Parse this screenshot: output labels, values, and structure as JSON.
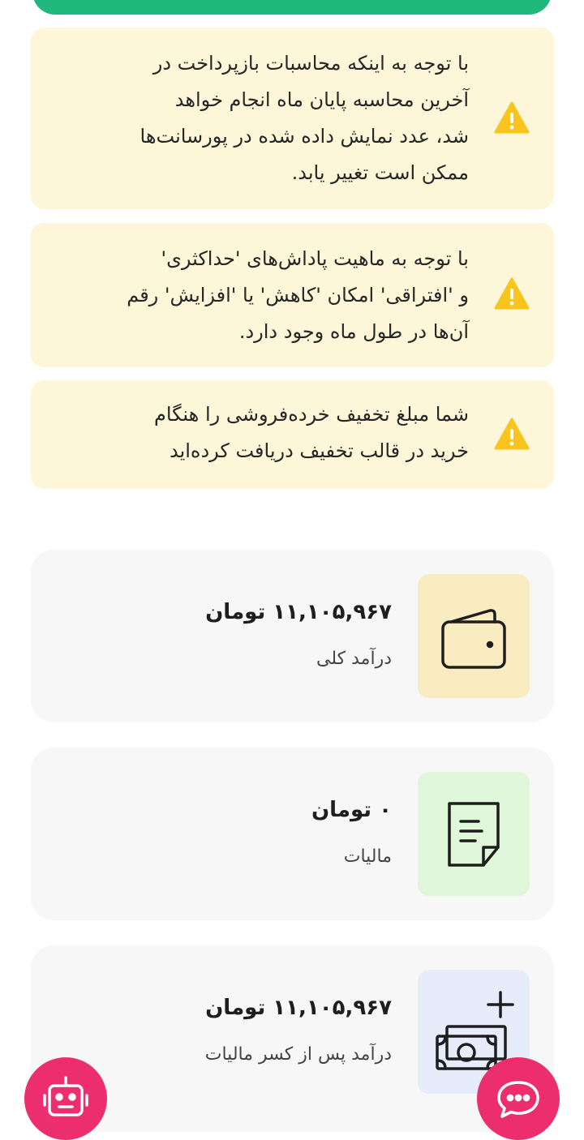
{
  "colors": {
    "accent_green": "#1fb77a",
    "notice_bg": "#fdf6d8",
    "warning_yellow": "#f7c51e",
    "card_bg": "#f7f7f7",
    "wallet_tile": "#f8ecc0",
    "tax_tile": "#e0f7d9",
    "net_tile": "#e7ecfb",
    "fab_pink": "#ec2e6f"
  },
  "notices": [
    {
      "icon": "warning-icon",
      "lines": [
        "با توجه به اینکه محاسبات بازپرداخت در",
        "آخرین محاسبه پایان ماه انجام خواهد",
        "شد، عدد نمایش داده شده در پورسانت‌ها",
        "ممکن است تغییر یابد."
      ]
    },
    {
      "icon": "warning-icon",
      "lines": [
        "با توجه به ماهیت پاداش‌های 'حداکثری'",
        "و 'افتراقی' امکان 'کاهش' یا 'افزایش' رقم",
        "آن‌ها در طول ماه وجود دارد."
      ]
    },
    {
      "icon": "warning-icon",
      "lines": [
        "شما مبلغ تخفیف خرده‌فروشی را هنگام",
        "خرید در قالب تخفیف دریافت کرده‌اید"
      ]
    }
  ],
  "cards": [
    {
      "icon": "wallet-icon",
      "amount": "۱۱,۱۰۵,۹۶۷ تومان",
      "label": "درآمد کلی"
    },
    {
      "icon": "tax-document-icon",
      "amount": "۰ تومان",
      "label": "مالیات"
    },
    {
      "icon": "money-plus-icon",
      "amount": "۱۱,۱۰۵,۹۶۷ تومان",
      "label": "درآمد پس از کسر مالیات"
    }
  ],
  "fabs": {
    "left_icon": "robot-icon",
    "right_icon": "chat-icon"
  }
}
